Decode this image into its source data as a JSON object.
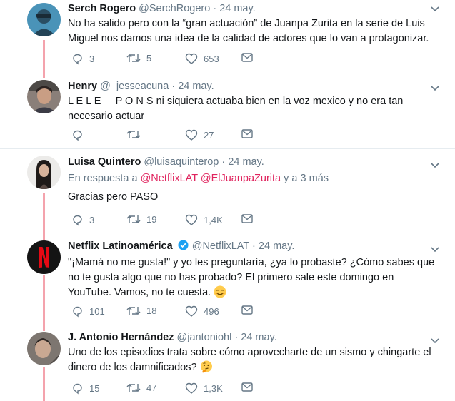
{
  "tweets": [
    {
      "name": "Serch Rogero",
      "handle": "@SerchRogero",
      "dot": "·",
      "time": "24 may.",
      "text": "No ha salido pero con la “gran actuación” de Juanpa Zurita en la serie de Luis Miguel nos damos una idea de la calidad de actores que lo van a protagonizar.",
      "replies": "3",
      "retweets": "5",
      "likes": "653"
    },
    {
      "name": "Henry",
      "handle": "@_jesseacuna",
      "dot": "·",
      "time": "24 may.",
      "text": "L E L E     P O N S ni siquiera actuaba bien en la voz mexico y no era tan necesario actuar",
      "replies": "",
      "retweets": "",
      "likes": "27"
    },
    {
      "name": "Luisa Quintero",
      "handle": "@luisaquinterop",
      "dot": "·",
      "time": "24 may.",
      "reply_prefix": "En respuesta a",
      "reply_mention_1": "@NetflixLAT",
      "reply_mention_2": "@ElJuanpaZurita",
      "reply_suffix": "y a 3 más",
      "text": "Gracias pero PASO",
      "replies": "3",
      "retweets": "19",
      "likes": "1,4K"
    },
    {
      "name": "Netflix Latinoamérica",
      "handle": "@NetflixLAT",
      "dot": "·",
      "time": "24 may.",
      "text": "\"¡Mamá no me gusta!\" y yo les preguntaría, ¿ya lo probaste? ¿Cómo sabes que no te gusta algo que no has probado? El primero sale este domingo en YouTube. Vamos, no te cuesta.",
      "replies": "101",
      "retweets": "18",
      "likes": "496"
    },
    {
      "name": "J. Antonio Hernández",
      "handle": "@jantoniohl",
      "dot": "·",
      "time": "24 may.",
      "text": "Uno de los episodios trata sobre cómo aprovecharte de un sismo y chingarte el dinero de los damnificados?",
      "replies": "15",
      "retweets": "47",
      "likes": "1,3K"
    }
  ],
  "colors": {
    "thread_line": "#f4a3ad",
    "mention": "#e0245e",
    "muted": "#657786",
    "verified": "#1da1f2",
    "netflix_red": "#e50914"
  },
  "icons": [
    "reply-icon",
    "retweet-icon",
    "like-icon",
    "dm-icon",
    "caret-down-icon",
    "verified-icon",
    "smiling-emoji",
    "thinking-emoji"
  ]
}
